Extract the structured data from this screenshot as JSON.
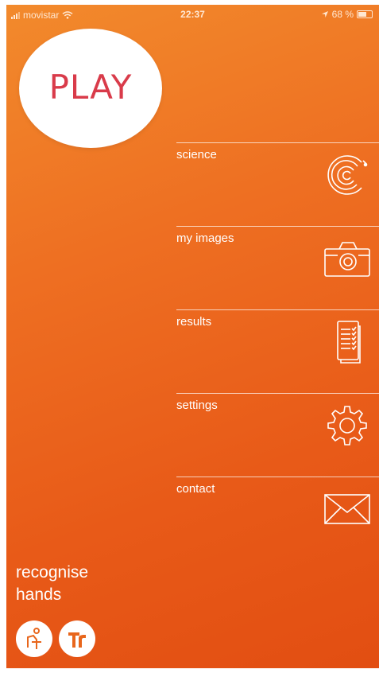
{
  "status_bar": {
    "carrier": "movistar",
    "time": "22:37",
    "battery": "68 %",
    "battery_level": 0.68
  },
  "play": {
    "label": "PLAY"
  },
  "menu": {
    "items": [
      {
        "label": "science",
        "icon": "spiral-icon"
      },
      {
        "label": "my images",
        "icon": "camera-icon"
      },
      {
        "label": "results",
        "icon": "document-icon"
      },
      {
        "label": "settings",
        "icon": "gear-icon"
      },
      {
        "label": "contact",
        "icon": "envelope-icon"
      }
    ]
  },
  "app": {
    "title_line1": "recognise",
    "title_line2": "hands"
  },
  "colors": {
    "background": "#ee6f22",
    "play_text": "#d93b4a",
    "menu_text": "#ffffff"
  }
}
